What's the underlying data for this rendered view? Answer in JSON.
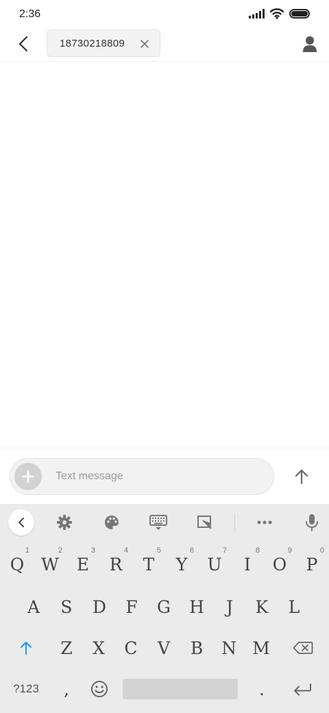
{
  "status_bar": {
    "time": "2:36"
  },
  "header": {
    "recipient": "18730218809",
    "back_icon": "chevron-left-icon",
    "contact_icon": "person-icon"
  },
  "composer": {
    "placeholder": "Text message",
    "attach_icon": "plus-icon",
    "send_icon": "arrow-up-icon"
  },
  "keyboard": {
    "toolbar": [
      "chevron-left-icon",
      "gear-icon",
      "palette-icon",
      "keyboard-icon",
      "resize-icon",
      "more-icon",
      "microphone-icon"
    ],
    "row1": [
      {
        "label": "Q",
        "hint": "1"
      },
      {
        "label": "W",
        "hint": "2"
      },
      {
        "label": "E",
        "hint": "3"
      },
      {
        "label": "R",
        "hint": "4"
      },
      {
        "label": "T",
        "hint": "5"
      },
      {
        "label": "Y",
        "hint": "6"
      },
      {
        "label": "U",
        "hint": "7"
      },
      {
        "label": "I",
        "hint": "8"
      },
      {
        "label": "O",
        "hint": "9"
      },
      {
        "label": "P",
        "hint": "0"
      }
    ],
    "row2": [
      "A",
      "S",
      "D",
      "F",
      "G",
      "H",
      "J",
      "K",
      "L"
    ],
    "row3": [
      "Z",
      "X",
      "C",
      "V",
      "B",
      "N",
      "M"
    ],
    "row4": {
      "symbols": "?123",
      "comma": ",",
      "period": "."
    },
    "accent_color": "#2196f3"
  }
}
